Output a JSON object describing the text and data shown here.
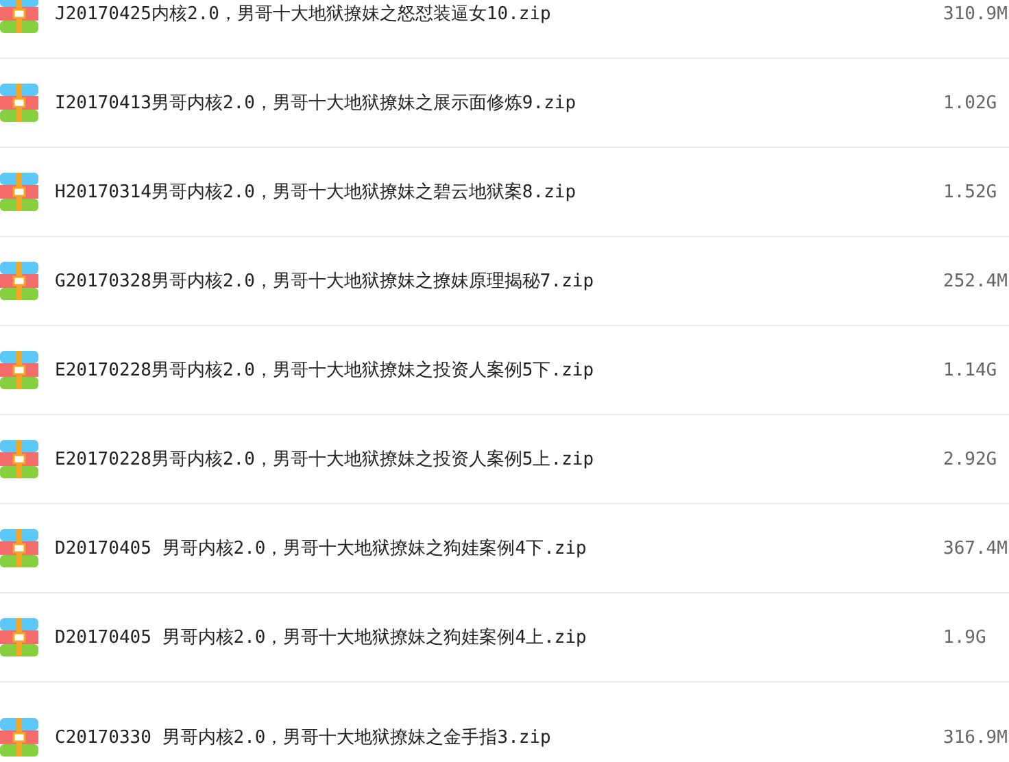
{
  "files": [
    {
      "name": "J20170425内核2.0，男哥十大地狱撩妹之怒怼装逼女10.zip",
      "size": "310.9M"
    },
    {
      "name": "I20170413男哥内核2.0，男哥十大地狱撩妹之展示面修炼9.zip",
      "size": "1.02G"
    },
    {
      "name": "H20170314男哥内核2.0，男哥十大地狱撩妹之碧云地狱案8.zip",
      "size": "1.52G"
    },
    {
      "name": "G20170328男哥内核2.0，男哥十大地狱撩妹之撩妹原理揭秘7.zip",
      "size": "252.4M"
    },
    {
      "name": "E20170228男哥内核2.0，男哥十大地狱撩妹之投资人案例5下.zip",
      "size": "1.14G"
    },
    {
      "name": "E20170228男哥内核2.0，男哥十大地狱撩妹之投资人案例5上.zip",
      "size": "2.92G"
    },
    {
      "name": "D20170405 男哥内核2.0，男哥十大地狱撩妹之狗娃案例4下.zip",
      "size": "367.4M"
    },
    {
      "name": "D20170405 男哥内核2.0，男哥十大地狱撩妹之狗娃案例4上.zip",
      "size": "1.9G"
    },
    {
      "name": "C20170330 男哥内核2.0，男哥十大地狱撩妹之金手指3.zip",
      "size": "316.9M"
    }
  ]
}
